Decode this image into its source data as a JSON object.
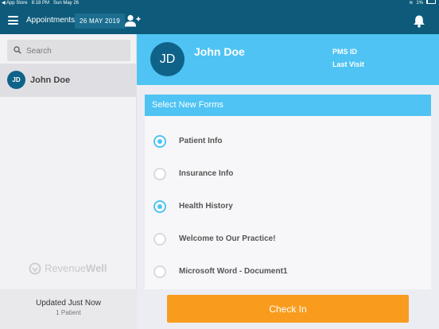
{
  "statusbar": {
    "back_app": "◀ App Store",
    "time": "8:18 PM",
    "date": "Sun May 26",
    "battery": "1%"
  },
  "navbar": {
    "title": "Appointments",
    "date": "26 MAY 2019"
  },
  "sidebar": {
    "search_placeholder": "Search",
    "patients": [
      {
        "initials": "JD",
        "name": "John Doe"
      }
    ],
    "logo": {
      "part1": "Revenue",
      "part2": "Well"
    },
    "footer": {
      "updated": "Updated Just Now",
      "count": "1 Patient"
    }
  },
  "patient": {
    "initials": "JD",
    "name": "John Doe",
    "pms_label": "PMS ID",
    "last_visit_label": "Last Visit"
  },
  "forms": {
    "title": "Select New Forms",
    "items": [
      {
        "label": "Patient Info",
        "selected": true
      },
      {
        "label": "Insurance Info",
        "selected": false
      },
      {
        "label": "Health History",
        "selected": true
      },
      {
        "label": "Welcome to Our Practice!",
        "selected": false
      },
      {
        "label": "Microsoft Word - Document1",
        "selected": false
      }
    ]
  },
  "actions": {
    "checkin_label": "Check In"
  },
  "colors": {
    "navbar": "#0d5a7a",
    "accent": "#4fc3f3",
    "checkin": "#f99b1d",
    "avatar": "#0f6388"
  }
}
